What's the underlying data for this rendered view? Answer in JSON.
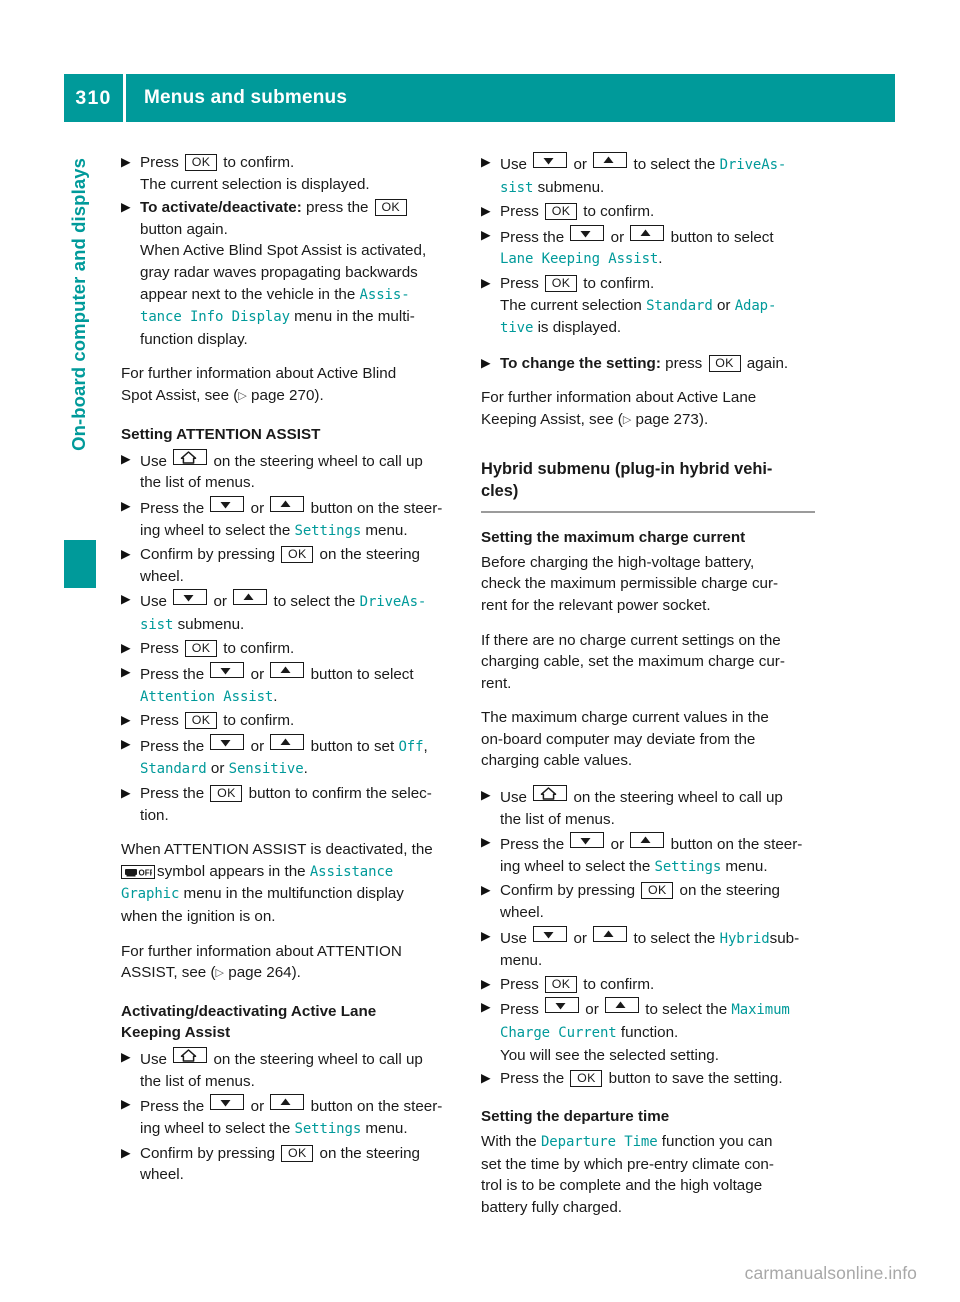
{
  "header": {
    "page_number": "310",
    "title": "Menus and submenus",
    "accent_color": "#009a9a"
  },
  "sidebar": {
    "label": "On-board computer and displays",
    "tab_color": "#009a9a"
  },
  "watermark": "carmanualsonline.info",
  "keys": {
    "ok": "OK",
    "down": "down-arrow",
    "up": "up-arrow",
    "home": "house",
    "off": "OFF"
  },
  "left_column": {
    "step_press_ok_confirm": {
      "lead": "Press",
      "after": "to confirm.",
      "sub": "The current selection is displayed."
    },
    "step_activate_deactivate": {
      "bold_lead": "To activate/deactivate:",
      "mid": "press the",
      "after": "button again.",
      "sub_1": "When Active Blind Spot Assist is activated,",
      "sub_2": "gray radar waves propagating backwards",
      "sub_3": "appear next to the vehicle in the",
      "menu_1": "Assis‐",
      "menu_2": "tance Info Display",
      "sub_4": "menu in the multi-",
      "sub_5": "function display."
    },
    "para_further_info_blind_spot": {
      "line_1": "For further information about Active Blind",
      "line_2": "Spot Assist, see (",
      "page_ref": "page 270",
      "line_3": ")."
    },
    "heading_attention_assist": "Setting ATTENTION ASSIST",
    "step_use_home": {
      "lead": "Use",
      "after": "on the steering wheel to call up",
      "sub": "the list of menus."
    },
    "step_press_updown_settings": {
      "lead": "Press the",
      "or": "or",
      "after": "button on the steer-",
      "sub_lead": "ing wheel to select the",
      "menu": "Settings",
      "sub_after": "menu."
    },
    "step_confirm_ok_wheel": {
      "lead": "Confirm by pressing",
      "after": "on the steering",
      "sub": "wheel."
    },
    "step_use_updown_driveassist": {
      "lead": "Use",
      "or": "or",
      "after": "to select the",
      "menu_1": "DriveAs‐",
      "menu_2": "sist",
      "sub_after": "submenu."
    },
    "step_press_ok_confirm_2": {
      "lead": "Press",
      "after": "to confirm."
    },
    "step_select_attention_assist": {
      "lead": "Press the",
      "or": "or",
      "after": "button to select",
      "menu": "Attention Assist",
      "sub_after": "."
    },
    "step_press_ok_confirm_3": {
      "lead": "Press",
      "after": "to confirm."
    },
    "step_set_off_standard_sensitive": {
      "lead": "Press the",
      "or": "or",
      "after": "button to set",
      "menu_off": "Off",
      "comma": ",",
      "menu_standard": "Standard",
      "or_2": "or",
      "menu_sensitive": "Sensitive",
      "period": "."
    },
    "step_press_ok_confirm_selection": {
      "lead": "Press the",
      "after": "button to confirm the selec-",
      "sub": "tion."
    },
    "para_attention_deactivated": {
      "line_1": "When ATTENTION ASSIST is deactivated, the",
      "line_2_after": "symbol appears in the",
      "menu_1": "Assistance",
      "menu_2": "Graphic",
      "line_3": "menu in the multifunction display",
      "line_4": "when the ignition is on."
    },
    "para_further_info_attention": {
      "line_1": "For further information about ATTENTION",
      "line_2": "ASSIST, see (",
      "page_ref": "page 264",
      "line_3": ")."
    },
    "heading_lane_keeping": {
      "line_1": "Activating/deactivating Active Lane",
      "line_2": "Keeping Assist"
    },
    "step_use_home_2": {
      "lead": "Use",
      "after": "on the steering wheel to call up",
      "sub": "the list of menus."
    },
    "step_press_updown_settings_2": {
      "lead": "Press the",
      "or": "or",
      "after": "button on the steer-",
      "sub_lead": "ing wheel to select the",
      "menu": "Settings",
      "sub_after": "menu."
    },
    "step_confirm_ok_wheel_2": {
      "lead": "Confirm by pressing",
      "after": "on the steering",
      "sub": "wheel."
    }
  },
  "right_column": {
    "step_use_updown_driveassist": {
      "lead": "Use",
      "or": "or",
      "after": "to select the",
      "menu_1": "DriveAs‐",
      "menu_2": "sist",
      "sub_after": "submenu."
    },
    "step_press_ok_confirm": {
      "lead": "Press",
      "after": "to confirm."
    },
    "step_select_lane_keeping": {
      "lead": "Press the",
      "or": "or",
      "after": "button to select",
      "menu": "Lane Keeping Assist",
      "sub_after": "."
    },
    "step_press_ok_confirm_2": {
      "lead": "Press",
      "after": "to confirm.",
      "sub_lead": "The current selection",
      "menu_standard": "Standard",
      "sub_or": "or",
      "menu_adaptive_1": "Adap‐",
      "menu_adaptive_2": "tive",
      "sub_after": "is displayed."
    },
    "step_change_setting": {
      "bold_lead": "To change the setting:",
      "mid": "press",
      "after": "again."
    },
    "para_further_info_lane": {
      "line_1": "For further information about Active Lane",
      "line_2": "Keeping Assist, see (",
      "page_ref": "page 273",
      "line_3": ")."
    },
    "section_heading_hybrid": {
      "line_1": "Hybrid submenu (plug-in hybrid vehi-",
      "line_2": "cles)"
    },
    "heading_max_charge": "Setting the maximum charge current",
    "para_before_charging": {
      "line_1": "Before charging the high-voltage battery,",
      "line_2": "check the maximum permissible charge cur-",
      "line_3": "rent for the relevant power socket."
    },
    "para_no_charge_settings": {
      "line_1": "If there are no charge current settings on the",
      "line_2": "charging cable, set the maximum charge cur-",
      "line_3": "rent."
    },
    "para_max_values": {
      "line_1": "The maximum charge current values in the",
      "line_2": "on-board computer may deviate from the",
      "line_3": "charging cable values."
    },
    "step_use_home": {
      "lead": "Use",
      "after": "on the steering wheel to call up",
      "sub": "the list of menus."
    },
    "step_press_updown_settings": {
      "lead": "Press the",
      "or": "or",
      "after": "button on the steer-",
      "sub_lead": "ing wheel to select the",
      "menu": "Settings",
      "sub_after": "menu."
    },
    "step_confirm_ok_wheel": {
      "lead": "Confirm by pressing",
      "after": "on the steering",
      "sub": "wheel."
    },
    "step_use_updown_hybrid": {
      "lead": "Use",
      "or": "or",
      "after": "to select the",
      "menu": "Hybrid",
      "sub_after": "sub-",
      "sub": "menu."
    },
    "step_press_ok_confirm_3": {
      "lead": "Press",
      "after": "to confirm."
    },
    "step_select_max_charge": {
      "lead": "Press",
      "or": "or",
      "after": "to select the",
      "menu_1": "Maximum",
      "menu_2": "Charge Current",
      "sub_after": "function.",
      "sub": "You will see the selected setting."
    },
    "step_press_ok_save": {
      "lead": "Press the",
      "after": "button to save the setting."
    },
    "heading_departure_time": "Setting the departure time",
    "para_departure_time": {
      "line_1_lead": "With the",
      "menu": "Departure Time",
      "line_1_after": "function you can",
      "line_2": "set the time by which pre-entry climate con-",
      "line_3": "trol is to be complete and the high voltage",
      "line_4": "battery fully charged."
    }
  }
}
